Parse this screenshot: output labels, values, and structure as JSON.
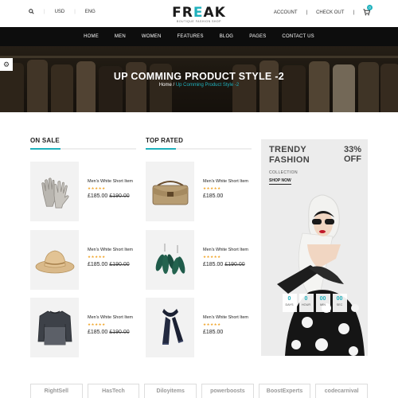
{
  "topbar": {
    "currency": "USD",
    "language": "ENG",
    "account": "ACCOUNT",
    "checkout": "CHECK OUT",
    "cart_count": "0"
  },
  "logo": {
    "word_a": "FR",
    "word_b": "E",
    "word_c": "AK",
    "tagline": "BOUTIQUE FASHION SHOP"
  },
  "nav": [
    "HOME",
    "MEN",
    "WOMEN",
    "FEATURES",
    "BLOG",
    "PAGES",
    "CONTACT US"
  ],
  "hero": {
    "title": "UP COMMING PRODUCT STYLE -2",
    "breadcrumb_home": "Home",
    "breadcrumb_sep": " / ",
    "breadcrumb_current": "Up Comming Product Style -2"
  },
  "on_sale": {
    "title": "ON SALE",
    "products": [
      {
        "name": "Men's White Short Item",
        "stars": "★★★★★",
        "price": "£185.00",
        "old_price": "£190.00",
        "icon": "gloves-icon"
      },
      {
        "name": "Men's White Short Item",
        "stars": "★★★★★",
        "price": "£185.00",
        "old_price": "£190.00",
        "icon": "straw-hat-icon"
      },
      {
        "name": "Men's White Short Item",
        "stars": "★★★★★",
        "price": "£185.00",
        "old_price": "£190.00",
        "icon": "sweater-icon"
      }
    ]
  },
  "top_rated": {
    "title": "TOP RATED",
    "products": [
      {
        "name": "Men's White Short Item",
        "stars": "★★★★★",
        "price": "£185.00",
        "old_price": "",
        "icon": "bag-icon"
      },
      {
        "name": "Men's White Short Item",
        "stars": "★★★★★",
        "price": "£185.00",
        "old_price": "£190.00",
        "icon": "earrings-icon"
      },
      {
        "name": "Men's White Short Item",
        "stars": "★★★★★",
        "price": "£185.00",
        "old_price": "",
        "icon": "scarf-icon"
      }
    ]
  },
  "banner": {
    "line1": "TRENDY",
    "line2": "FASHION",
    "collection": "COLLECTION",
    "shop_now": "SHOP NOW",
    "pct": "33%",
    "off": "OFF",
    "countdown": [
      {
        "value": "0",
        "label": "DAYS"
      },
      {
        "value": "0",
        "label": "HOUR"
      },
      {
        "value": "00",
        "label": "MIN"
      },
      {
        "value": "00",
        "label": "SEC"
      }
    ]
  },
  "brands": [
    "RightSell",
    "HasTech",
    "Diloyitems",
    "powerboosts",
    "BoostExperts",
    "codecarnival"
  ],
  "colors": {
    "accent": "#1fb1bd",
    "nav_bg": "#0d0d0d",
    "star": "#f0a52b"
  }
}
